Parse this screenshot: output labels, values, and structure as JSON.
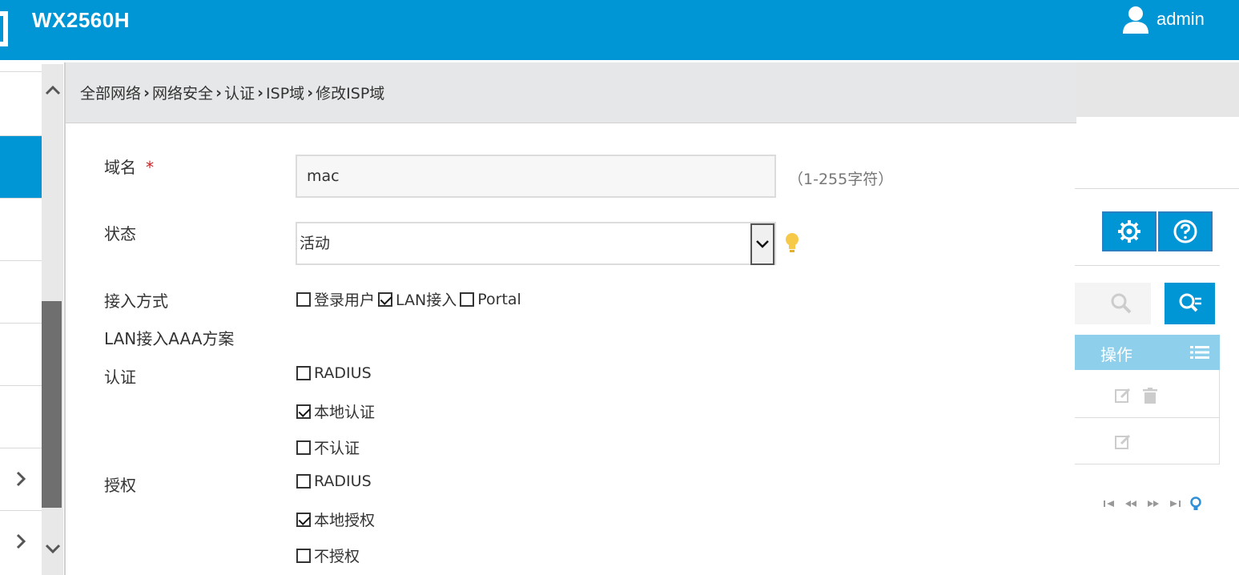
{
  "header": {
    "product": "WX2560H",
    "user": "admin"
  },
  "breadcrumb": [
    "全部网络",
    "网络安全",
    "认证",
    "ISP域",
    "修改ISP域"
  ],
  "form": {
    "domain_label": "域名",
    "required_mark": "*",
    "domain_value": "mac",
    "domain_hint": "（1-255字符）",
    "state_label": "状态",
    "state_value": "活动",
    "access_label": "接入方式",
    "access_options": [
      {
        "label": "登录用户",
        "checked": false
      },
      {
        "label": "LAN接入",
        "checked": true
      },
      {
        "label": "Portal",
        "checked": false
      }
    ],
    "lan_aaa_label": "LAN接入AAA方案",
    "auth_label": "认证",
    "auth_options": [
      {
        "label": "RADIUS",
        "checked": false
      },
      {
        "label": "本地认证",
        "checked": true
      },
      {
        "label": "不认证",
        "checked": false
      }
    ],
    "authz_label": "授权",
    "authz_options": [
      {
        "label": "RADIUS",
        "checked": false
      },
      {
        "label": "本地授权",
        "checked": true
      },
      {
        "label": "不授权",
        "checked": false
      }
    ]
  },
  "background": {
    "operation_header": "操作"
  },
  "colors": {
    "brand": "#0096d6",
    "table_header": "#8ecfeb"
  }
}
